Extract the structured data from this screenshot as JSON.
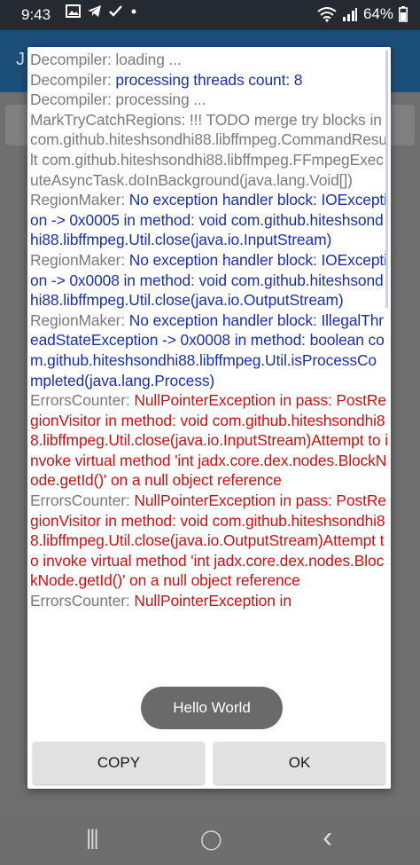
{
  "status_bar": {
    "time": "9:43",
    "icons_left": [
      "image-icon",
      "telegram-icon",
      "check-icon",
      "dot-icon"
    ],
    "icons_right": [
      "wifi-icon",
      "signal-icon"
    ],
    "battery": "64%"
  },
  "app": {
    "title_partial": "J"
  },
  "dialog": {
    "log": [
      {
        "tag": "Decompiler:",
        "msg": " loading ...",
        "level": "debug"
      },
      {
        "tag": "Decompiler:",
        "msg": " processing threads count: 8",
        "level": "info"
      },
      {
        "tag": "Decompiler:",
        "msg": " processing ...",
        "level": "debug"
      },
      {
        "tag": "MarkTryCatchRegions:",
        "msg": " !!! TODO merge try blocks in com.github.hiteshsondhi88.libffmpeg.CommandResult com.github.hiteshsondhi88.libffmpeg.FFmpegExecuteAsyncTask.doInBackground(java.lang.Void[])",
        "level": "debug"
      },
      {
        "tag": "RegionMaker:",
        "msg": " No exception handler block: IOException -> 0x0005 in method: void com.github.hiteshsondhi88.libffmpeg.Util.close(java.io.InputStream)",
        "level": "warn"
      },
      {
        "tag": "RegionMaker:",
        "msg": " No exception handler block: IOException -> 0x0008 in method: void com.github.hiteshsondhi88.libffmpeg.Util.close(java.io.OutputStream)",
        "level": "warn"
      },
      {
        "tag": "RegionMaker:",
        "msg": " No exception handler block: IllegalThreadStateException -> 0x0008 in method: boolean com.github.hiteshsondhi88.libffmpeg.Util.isProcessCompleted(java.lang.Process)",
        "level": "warn"
      },
      {
        "tag": "ErrorsCounter:",
        "msg": " NullPointerException in pass: PostRegionVisitor in method: void com.github.hiteshsondhi88.libffmpeg.Util.close(java.io.InputStream)Attempt to invoke virtual method 'int jadx.core.dex.nodes.BlockNode.getId()' on a null object reference",
        "level": "err"
      },
      {
        "tag": "ErrorsCounter:",
        "msg": " NullPointerException in pass: PostRegionVisitor in method: void com.github.hiteshsondhi88.libffmpeg.Util.close(java.io.OutputStream)Attempt to invoke virtual method 'int jadx.core.dex.nodes.BlockNode.getId()' on a null object reference",
        "level": "err"
      },
      {
        "tag": "ErrorsCounter:",
        "msg": " NullPointerException in",
        "level": "err"
      }
    ],
    "copy_label": "COPY",
    "ok_label": "OK"
  },
  "toast": {
    "text": "Hello World"
  },
  "nav_bar": {
    "recents": "|||",
    "home": "◯",
    "back": "‹"
  }
}
